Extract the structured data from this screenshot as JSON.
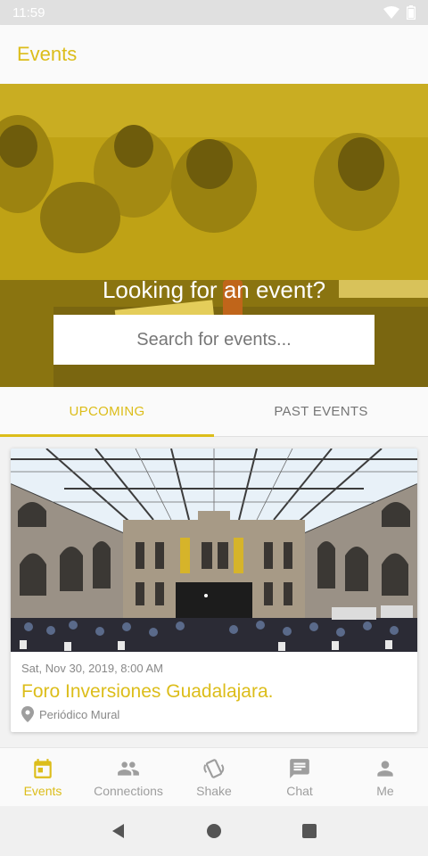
{
  "status_bar": {
    "time": "11:59"
  },
  "app_bar": {
    "title": "Events"
  },
  "hero": {
    "title": "Looking for an event?",
    "search_placeholder": "Search for events..."
  },
  "tabs": [
    {
      "label": "UPCOMING",
      "active": true
    },
    {
      "label": "PAST EVENTS",
      "active": false
    }
  ],
  "events": [
    {
      "date": "Sat, Nov 30, 2019, 8:00 AM",
      "title": "Foro Inversiones Guadalajara.",
      "location": "Periódico Mural"
    }
  ],
  "bottom_nav": [
    {
      "label": "Events",
      "icon": "calendar-icon",
      "active": true
    },
    {
      "label": "Connections",
      "icon": "people-icon",
      "active": false
    },
    {
      "label": "Shake",
      "icon": "shake-phone-icon",
      "active": false
    },
    {
      "label": "Chat",
      "icon": "chat-icon",
      "active": false
    },
    {
      "label": "Me",
      "icon": "person-icon",
      "active": false
    }
  ],
  "colors": {
    "accent": "#dcbd1a",
    "inactive": "#9e9e9e"
  }
}
